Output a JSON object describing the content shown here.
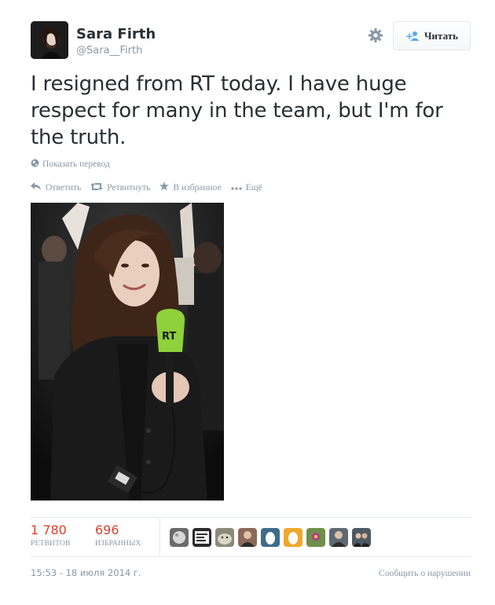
{
  "user": {
    "name": "Sara Firth",
    "handle": "@Sara__Firth"
  },
  "follow_button": {
    "label": "Читать",
    "icon": "add-user-icon"
  },
  "tweet": {
    "lines": [
      "I resigned from RT today. I have huge",
      "respect for many in the team, but I'm for",
      "the truth."
    ]
  },
  "translate": {
    "label": "Показать перевод",
    "icon": "globe-icon"
  },
  "actions": {
    "reply": "Ответить",
    "retweet": "Ретвитнуть",
    "favorite": "В избранное",
    "more": "Ещё"
  },
  "photo": {
    "microphone_text": "RT"
  },
  "stats": {
    "retweets": {
      "count": "1 780",
      "label": "РЕТВИТОВ"
    },
    "favorites": {
      "count": "696",
      "label": "ИЗБРАННЫХ"
    }
  },
  "favoriters": [
    {
      "icon": "favoriter-avatar-moon",
      "color": "#6b6b6b"
    },
    {
      "icon": "favoriter-avatar-text",
      "color": "#2a2a2a"
    },
    {
      "icon": "favoriter-avatar-seal",
      "color": "#8a8a7a"
    },
    {
      "icon": "favoriter-avatar-person",
      "color": "#8c6a5a"
    },
    {
      "icon": "favoriter-avatar-egg",
      "color": "#3f6c8a"
    },
    {
      "icon": "favoriter-avatar-egg",
      "color": "#f0a72d"
    },
    {
      "icon": "favoriter-avatar-flower",
      "color": "#6f8f4a"
    },
    {
      "icon": "favoriter-avatar-person",
      "color": "#5d6a72"
    },
    {
      "icon": "favoriter-avatar-group",
      "color": "#4e5a62"
    }
  ],
  "footer": {
    "timestamp": "15:53 - 18 июля 2014 г.",
    "report": "Сообщить о нарушении"
  },
  "colors": {
    "accent": "#e0422c",
    "muted": "#8899a6",
    "text": "#292f33",
    "link": "#55acee"
  }
}
